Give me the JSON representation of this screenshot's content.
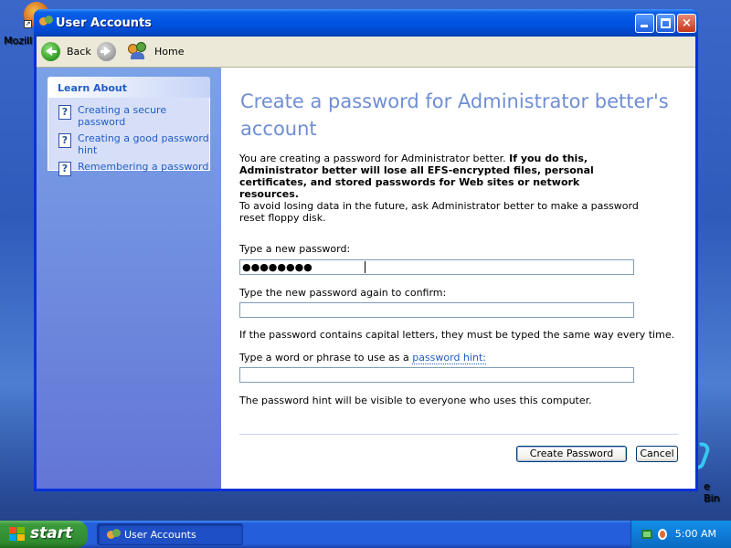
{
  "desktop": {
    "icon_mozilla_label": "Mozill",
    "icon_recycle_label": "e Bin"
  },
  "window": {
    "title": "User Accounts",
    "controls": {
      "minimize": "minimize",
      "maximize": "maximize",
      "close": "×"
    }
  },
  "toolbar": {
    "back_label": "Back",
    "forward_label": "",
    "home_label": "Home"
  },
  "sidebar": {
    "header": "Learn About",
    "items": [
      {
        "label": "Creating a secure password",
        "icon": "help-icon"
      },
      {
        "label": "Creating a good password hint",
        "icon": "help-icon"
      },
      {
        "label": "Remembering a password",
        "icon": "help-icon"
      }
    ]
  },
  "main": {
    "heading": "Create a password for Administrator better's account",
    "para1_normal": "You are creating a password for Administrator better. ",
    "para1_bold": "If you do this, Administrator better will lose all EFS-encrypted files, personal certificates, and stored passwords for Web sites or network resources.",
    "para2": "To avoid losing data in the future, ask Administrator better to make a password reset floppy disk.",
    "new_password_label": "Type a new password:",
    "new_password_value": "●●●●●●●●",
    "confirm_label": "Type the new password again to confirm:",
    "confirm_value": "",
    "caps_note": "If the password contains capital letters, they must be typed the same way every time.",
    "hint_label_prefix": "Type a word or phrase to use as a ",
    "hint_label_link": "password hint:",
    "hint_value": "",
    "hint_note": "The password hint will be visible to everyone who uses this computer.",
    "create_button": "Create Password",
    "cancel_button": "Cancel"
  },
  "taskbar": {
    "start_label": "start",
    "task_label": "User Accounts",
    "clock": "5:00 AM"
  },
  "colors": {
    "title_blue": "#0054e3",
    "heading_blue": "#6f8ed4",
    "link_blue": "#215dc6",
    "start_green": "#3c9a3c"
  }
}
